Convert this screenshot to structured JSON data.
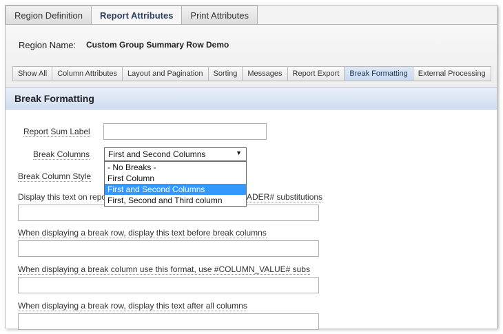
{
  "top_tabs": [
    "Region Definition",
    "Report Attributes",
    "Print Attributes"
  ],
  "region": {
    "label": "Region Name:",
    "value": "Custom Group Summary Row Demo"
  },
  "sub_tabs": [
    "Show All",
    "Column Attributes",
    "Layout and Pagination",
    "Sorting",
    "Messages",
    "Report Export",
    "Break Formatting",
    "External Processing"
  ],
  "section": {
    "title": "Break Formatting"
  },
  "fields": {
    "report_sum_label": {
      "label": "Report Sum Label",
      "value": ""
    },
    "break_columns": {
      "label": "Break Columns",
      "selected": "First and Second Columns",
      "options": [
        "- No Breaks -",
        "First Column",
        "First and Second Columns",
        "First, Second and Third column"
      ]
    },
    "break_column_style": {
      "label": "Break Column Style"
    },
    "display_text_on": {
      "label_left": "Display this text on repo",
      "label_right": "ADER# substitutions",
      "value": ""
    },
    "before_break": {
      "label": "When displaying a break row, display this text before break columns",
      "value": ""
    },
    "break_column_format": {
      "label": "When displaying a break column use this format, use #COLUMN_VALUE# subs",
      "value": ""
    },
    "after_columns": {
      "label": "When displaying a break row, display this text after all columns",
      "value": ""
    }
  }
}
